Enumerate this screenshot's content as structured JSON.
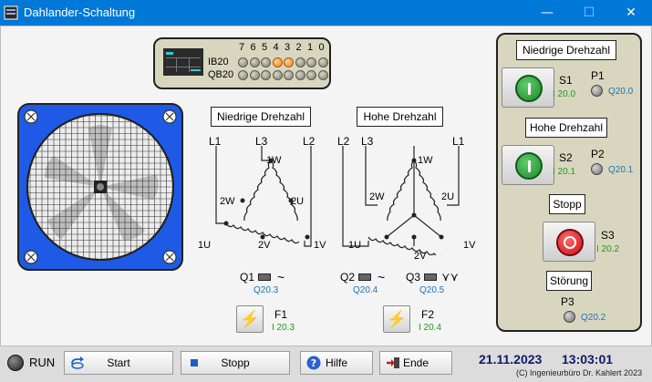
{
  "window": {
    "title": "Dahlander-Schaltung",
    "min": "—",
    "max": "☐",
    "close": "✕"
  },
  "plc": {
    "bits": [
      "7",
      "6",
      "5",
      "4",
      "3",
      "2",
      "1",
      "0"
    ],
    "ib_label": "IB20",
    "qb_label": "QB20",
    "ib_states": [
      false,
      false,
      false,
      true,
      true,
      false,
      false,
      false
    ],
    "qb_states": [
      false,
      false,
      false,
      false,
      false,
      false,
      false,
      false
    ]
  },
  "diagram_low": {
    "title": "Niedrige Drehzahl",
    "l1": "L1",
    "l2": "L2",
    "l3": "L3",
    "n1w": "1W",
    "n2w": "2W",
    "n2u": "2U",
    "n1u": "1U",
    "n2v": "2V",
    "n1v": "1V"
  },
  "diagram_high": {
    "title": "Hohe Drehzahl",
    "l1": "L1",
    "l2": "L2",
    "l3": "L3",
    "n1w": "1W",
    "n2w": "2W",
    "n2u": "2U",
    "n1u": "1U",
    "n2v": "2V",
    "n1v": "1V"
  },
  "contactors": {
    "q1": {
      "label": "Q1",
      "addr": "Q20.3",
      "symbol": "~"
    },
    "q2": {
      "label": "Q2",
      "addr": "Q20.4",
      "symbol": "~"
    },
    "q3": {
      "label": "Q3",
      "addr": "Q20.5",
      "symbol": "⋎⋎"
    }
  },
  "fuses": {
    "f1": {
      "label": "F1",
      "addr": "I 20.3"
    },
    "f2": {
      "label": "F2",
      "addr": "I 20.4"
    }
  },
  "control": {
    "low_title": "Niedrige Drehzahl",
    "high_title": "Hohe Drehzahl",
    "stop_title": "Stopp",
    "fault_title": "Störung",
    "s1": {
      "label": "S1",
      "addr": "I 20.0"
    },
    "p1": {
      "label": "P1",
      "addr": "Q20.0"
    },
    "s2": {
      "label": "S2",
      "addr": "I 20.1"
    },
    "p2": {
      "label": "P2",
      "addr": "Q20.1"
    },
    "s3": {
      "label": "S3",
      "addr": "I 20.2"
    },
    "p3": {
      "label": "P3",
      "addr": "Q20.2"
    }
  },
  "bottom": {
    "run_label": "RUN",
    "start_label": "Start",
    "stopp_label": "Stopp",
    "hilfe_label": "Hilfe",
    "ende_label": "Ende",
    "date": "21.11.2023",
    "time": "13:03:01",
    "copyright": "(C) Ingenieurbüro Dr. Kahlert 2023"
  },
  "colors": {
    "titlebar": "#0078d7",
    "green_button": "#2e9e3e",
    "red_button": "#e0202a",
    "fan_frame": "#1e5ae6"
  }
}
